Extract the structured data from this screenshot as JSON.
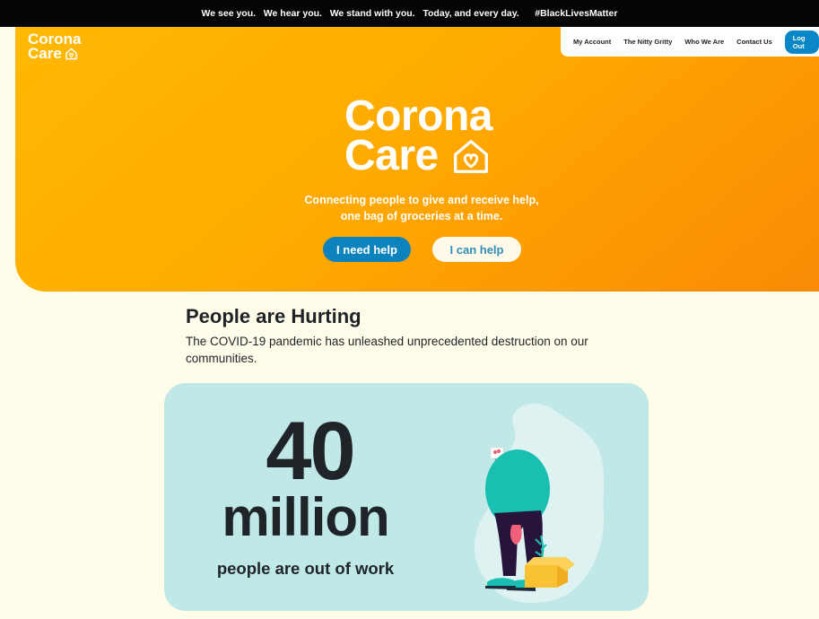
{
  "announcement": {
    "message": "We see you.   We hear you.   We stand with you.   Today, and every day.      #BlackLivesMatter"
  },
  "brand": {
    "line1": "Corona",
    "line2": "Care"
  },
  "nav": {
    "items": [
      "My Account",
      "The Nitty Gritty",
      "Who We Are",
      "Contact Us"
    ],
    "logout_label": "Log Out"
  },
  "hero": {
    "logo_line1": "Corona",
    "logo_line2": "Care",
    "tagline_line1": "Connecting people to give and receive help,",
    "tagline_line2": "one bag of groceries at a time.",
    "need_help_label": "I need help",
    "can_help_label": "I can help"
  },
  "section": {
    "title": "People are Hurting",
    "text": "The COVID-19 pandemic has unleashed unprecedented destruction on our communities."
  },
  "stat": {
    "number": "40",
    "unit": "million",
    "description": "people are out of work"
  },
  "colors": {
    "accent_blue": "#0a87c6",
    "hero_orange": "#ffab00",
    "background": "#fffdea",
    "card_teal": "#bfe8e6"
  },
  "icons": {
    "brand_small": "house-heart-icon",
    "hero": "house-heart-icon"
  }
}
